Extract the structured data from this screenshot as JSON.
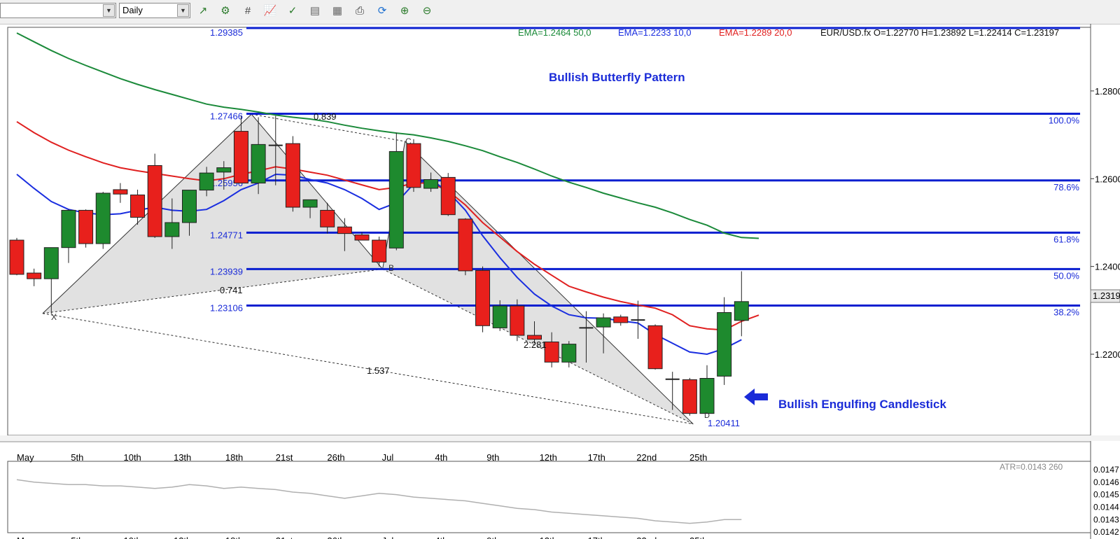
{
  "toolbar": {
    "timeframe": "Daily",
    "icons": [
      "chart-add-icon",
      "chart-settings-icon",
      "crosshair-icon",
      "line-chart-icon",
      "check-chart-icon",
      "indicator-icon",
      "template-icon",
      "print-icon",
      "refresh-icon",
      "zoom-in-icon",
      "zoom-out-icon"
    ]
  },
  "header": {
    "ema50": "EMA=1.2464  50,0",
    "ema10": "EMA=1.2233  10,0",
    "ema20": "EMA=1.2289  20,0",
    "ohlc": "EUR/USD.fx O=1.22770 H=1.23892 L=1.22414 C=1.23197",
    "top_price": "1.29385"
  },
  "colors": {
    "bull": "#1e8a2e",
    "bear": "#e8201c",
    "fib": "#0a1fd0",
    "ema10": "#1a2ee0",
    "ema20": "#e02020",
    "ema50": "#1b8a3a",
    "annotation": "#1a2bd8"
  },
  "annotations": {
    "pattern_title": "Bullish Butterfly Pattern",
    "candle_note": "Bullish Engulfing Candlestick",
    "low_price": "1.20411",
    "ratio_xb": "0.741",
    "ratio_ac": "0.839",
    "ratio_bd": "2.281",
    "ratio_xd": "1.537",
    "point_x": "X",
    "point_b": "B",
    "point_c": "C",
    "point_d": "D"
  },
  "atr_label": "ATR=0.0143  260",
  "chart_data": {
    "type": "candlestick",
    "symbol": "EUR/USD.fx",
    "timeframe": "Daily",
    "ylim": [
      1.2015,
      1.2945
    ],
    "y_ticks": [
      "1.2800",
      "1.2600",
      "1.2400",
      "1.2200"
    ],
    "current_price_label": "1.2319",
    "x_labels": [
      "ay",
      "May",
      "5th",
      "10th",
      "13th",
      "18th",
      "21st",
      "26th",
      "Jul",
      "4th",
      "9th",
      "12th",
      "17th",
      "22nd",
      "25th"
    ],
    "x_label_index": [
      -2.5,
      0.5,
      3.5,
      6.7,
      9.6,
      12.6,
      15.5,
      18.5,
      21.5,
      24.6,
      27.6,
      30.8,
      33.6,
      36.5,
      39.5
    ],
    "candles": [
      {
        "o": 1.246,
        "h": 1.2465,
        "l": 1.238,
        "c": 1.2382
      },
      {
        "o": 1.2385,
        "h": 1.2395,
        "l": 1.2355,
        "c": 1.2372
      },
      {
        "o": 1.2372,
        "h": 1.2435,
        "l": 1.2292,
        "c": 1.2443
      },
      {
        "o": 1.2443,
        "h": 1.253,
        "l": 1.2408,
        "c": 1.2528
      },
      {
        "o": 1.2528,
        "h": 1.253,
        "l": 1.2443,
        "c": 1.2452
      },
      {
        "o": 1.2452,
        "h": 1.257,
        "l": 1.244,
        "c": 1.2567
      },
      {
        "o": 1.2575,
        "h": 1.259,
        "l": 1.2545,
        "c": 1.2565
      },
      {
        "o": 1.2563,
        "h": 1.2575,
        "l": 1.2495,
        "c": 1.2512
      },
      {
        "o": 1.263,
        "h": 1.2657,
        "l": 1.2465,
        "c": 1.2468
      },
      {
        "o": 1.2468,
        "h": 1.2555,
        "l": 1.244,
        "c": 1.25
      },
      {
        "o": 1.25,
        "h": 1.2574,
        "l": 1.247,
        "c": 1.2574
      },
      {
        "o": 1.2574,
        "h": 1.2627,
        "l": 1.256,
        "c": 1.2613
      },
      {
        "o": 1.2615,
        "h": 1.264,
        "l": 1.2575,
        "c": 1.2625
      },
      {
        "o": 1.2708,
        "h": 1.2743,
        "l": 1.259,
        "c": 1.259
      },
      {
        "o": 1.259,
        "h": 1.274,
        "l": 1.2565,
        "c": 1.2678
      },
      {
        "o": 1.2676,
        "h": 1.2743,
        "l": 1.2585,
        "c": 1.2676
      },
      {
        "o": 1.268,
        "h": 1.2697,
        "l": 1.2525,
        "c": 1.2535
      },
      {
        "o": 1.2535,
        "h": 1.255,
        "l": 1.251,
        "c": 1.2552
      },
      {
        "o": 1.2528,
        "h": 1.2545,
        "l": 1.2475,
        "c": 1.249
      },
      {
        "o": 1.249,
        "h": 1.251,
        "l": 1.2435,
        "c": 1.2475
      },
      {
        "o": 1.2472,
        "h": 1.2478,
        "l": 1.2465,
        "c": 1.246
      },
      {
        "o": 1.246,
        "h": 1.2468,
        "l": 1.24,
        "c": 1.241
      },
      {
        "o": 1.2442,
        "h": 1.2705,
        "l": 1.2437,
        "c": 1.2662
      },
      {
        "o": 1.268,
        "h": 1.269,
        "l": 1.257,
        "c": 1.258
      },
      {
        "o": 1.2578,
        "h": 1.2614,
        "l": 1.257,
        "c": 1.2598
      },
      {
        "o": 1.2603,
        "h": 1.2613,
        "l": 1.2515,
        "c": 1.2518
      },
      {
        "o": 1.2508,
        "h": 1.251,
        "l": 1.238,
        "c": 1.239
      },
      {
        "o": 1.2391,
        "h": 1.24,
        "l": 1.225,
        "c": 1.2265
      },
      {
        "o": 1.226,
        "h": 1.2323,
        "l": 1.2253,
        "c": 1.231
      },
      {
        "o": 1.231,
        "h": 1.2325,
        "l": 1.223,
        "c": 1.2243
      },
      {
        "o": 1.2243,
        "h": 1.2275,
        "l": 1.2225,
        "c": 1.2234
      },
      {
        "o": 1.2228,
        "h": 1.225,
        "l": 1.217,
        "c": 1.2182
      },
      {
        "o": 1.2182,
        "h": 1.223,
        "l": 1.217,
        "c": 1.2223
      },
      {
        "o": 1.226,
        "h": 1.2298,
        "l": 1.2181,
        "c": 1.226
      },
      {
        "o": 1.2262,
        "h": 1.2293,
        "l": 1.2202,
        "c": 1.2283
      },
      {
        "o": 1.2285,
        "h": 1.229,
        "l": 1.2265,
        "c": 1.2272
      },
      {
        "o": 1.228,
        "h": 1.2322,
        "l": 1.2235,
        "c": 1.2278
      },
      {
        "o": 1.2265,
        "h": 1.2268,
        "l": 1.2165,
        "c": 1.2167
      },
      {
        "o": 1.2143,
        "h": 1.216,
        "l": 1.2073,
        "c": 1.2143
      },
      {
        "o": 1.2142,
        "h": 1.2146,
        "l": 1.206,
        "c": 1.2065
      },
      {
        "o": 1.2065,
        "h": 1.2175,
        "l": 1.2065,
        "c": 1.2145
      },
      {
        "o": 1.215,
        "h": 1.233,
        "l": 1.213,
        "c": 1.2295
      },
      {
        "o": 1.2277,
        "h": 1.2389,
        "l": 1.2241,
        "c": 1.232
      }
    ],
    "series": [
      {
        "name": "EMA 50",
        "values": [
          1.2932,
          1.2912,
          1.2892,
          1.2874,
          1.2858,
          1.2843,
          1.2828,
          1.2815,
          1.2803,
          1.2792,
          1.2781,
          1.277,
          1.2763,
          1.2758,
          1.2752,
          1.2745,
          1.274,
          1.2736,
          1.273,
          1.2722,
          1.2715,
          1.2709,
          1.2704,
          1.27,
          1.2693,
          1.2685,
          1.2675,
          1.2664,
          1.265,
          1.2637,
          1.2622,
          1.2606,
          1.2592,
          1.258,
          1.2567,
          1.2556,
          1.2545,
          1.2535,
          1.2522,
          1.2507,
          1.2494,
          1.2476,
          1.2466,
          1.2464
        ]
      },
      {
        "name": "EMA 20",
        "values": [
          1.273,
          1.2705,
          1.2683,
          1.2665,
          1.265,
          1.2636,
          1.2625,
          1.2618,
          1.2612,
          1.2606,
          1.26,
          1.2595,
          1.26,
          1.261,
          1.2618,
          1.2627,
          1.2622,
          1.2615,
          1.2608,
          1.2597,
          1.2586,
          1.2575,
          1.258,
          1.259,
          1.259,
          1.2572,
          1.254,
          1.25,
          1.2467,
          1.2434,
          1.2405,
          1.238,
          1.2355,
          1.2342,
          1.233,
          1.232,
          1.2312,
          1.2305,
          1.229,
          1.2265,
          1.2258,
          1.2255,
          1.2275,
          1.2289
        ]
      },
      {
        "name": "EMA 10",
        "values": [
          1.261,
          1.2578,
          1.2548,
          1.253,
          1.2522,
          1.2518,
          1.252,
          1.2528,
          1.2535,
          1.2528,
          1.2526,
          1.253,
          1.255,
          1.2575,
          1.259,
          1.261,
          1.2608,
          1.2598,
          1.259,
          1.2575,
          1.2555,
          1.253,
          1.2545,
          1.2588,
          1.2598,
          1.257,
          1.2528,
          1.247,
          1.242,
          1.2375,
          1.2337,
          1.231,
          1.229,
          1.2283,
          1.2282,
          1.2276,
          1.2271,
          1.2245,
          1.2225,
          1.2205,
          1.22,
          1.2213,
          1.2233
        ]
      }
    ],
    "fib_levels": [
      {
        "price": 1.2748,
        "label": "1.27466",
        "pct": "100.0%"
      },
      {
        "price": 1.2596,
        "label": "1.25956",
        "pct": "78.6%"
      },
      {
        "price": 1.2477,
        "label": "1.24771",
        "pct": "61.8%"
      },
      {
        "price": 1.2394,
        "label": "1.23939",
        "pct": "50.0%"
      },
      {
        "price": 1.2311,
        "label": "1.23106",
        "pct": "38.2%"
      }
    ],
    "pattern_points": {
      "X": [
        1.5,
        1.2293
      ],
      "A": [
        13.6,
        1.2747
      ],
      "B": [
        21.2,
        1.2394
      ],
      "C": [
        22.5,
        1.2685
      ],
      "D": [
        39.2,
        1.2041
      ]
    },
    "atr": {
      "label": "ATR=0.0143  260",
      "ylim": [
        0.01415,
        0.01475
      ],
      "y_ticks": [
        "0.0147",
        "0.0146",
        "0.0145",
        "0.0144",
        "0.0143",
        "0.0142"
      ],
      "values": [
        0.01462,
        0.0146,
        0.01459,
        0.01458,
        0.01458,
        0.01457,
        0.01457,
        0.01456,
        0.01455,
        0.01456,
        0.01458,
        0.01457,
        0.01455,
        0.01456,
        0.01455,
        0.01454,
        0.01452,
        0.01451,
        0.01449,
        0.01447,
        0.01449,
        0.01451,
        0.0145,
        0.01448,
        0.01447,
        0.01446,
        0.01445,
        0.01443,
        0.01441,
        0.01439,
        0.01438,
        0.01436,
        0.01435,
        0.01434,
        0.01433,
        0.01432,
        0.01431,
        0.01429,
        0.01428,
        0.01427,
        0.01428,
        0.0143,
        0.0143
      ]
    }
  }
}
